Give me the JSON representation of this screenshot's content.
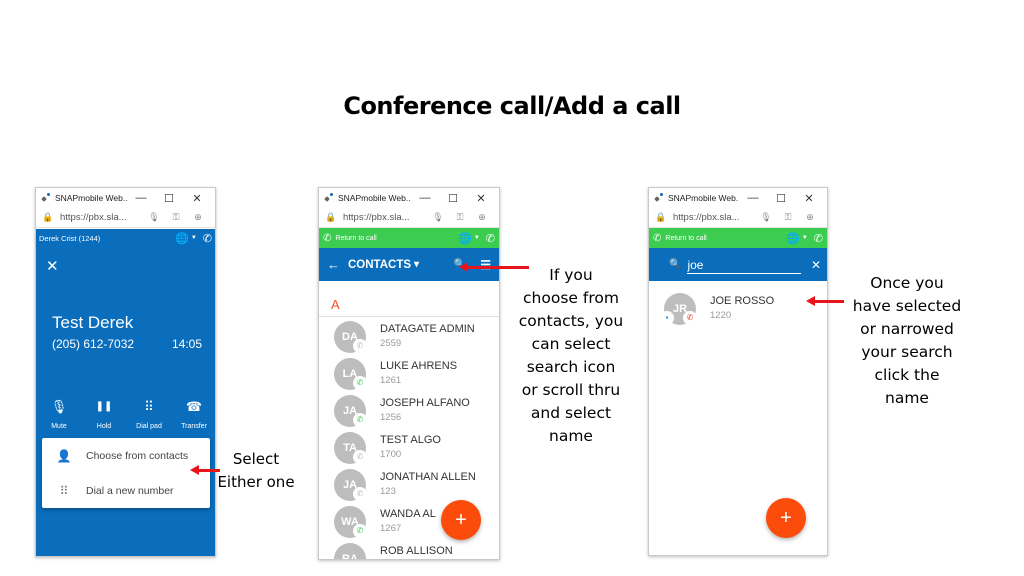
{
  "page_title": "Conference call/Add a call",
  "browser": {
    "window_title": "SNAPmobile Web...",
    "minimize": "—",
    "maximize": "☐",
    "close": "✕",
    "url": "https://pbx.sla...",
    "lock_icon": "🔒",
    "mic_icon": "🎙",
    "key_icon": "⚿",
    "zoom_icon": "⊕"
  },
  "panel1": {
    "user_label": "Derek Crist (1244)",
    "close_glyph": "✕",
    "caller_name": "Test Derek",
    "caller_number": "(205) 612-7032",
    "call_timer": "14:05",
    "controls": [
      {
        "label": "Mute",
        "icon": "🎙"
      },
      {
        "label": "Hold",
        "icon": "❚❚"
      },
      {
        "label": "Dial pad",
        "icon": "⠿"
      },
      {
        "label": "Transfer",
        "icon": "☎"
      }
    ],
    "menu": [
      {
        "label": "Choose from contacts",
        "icon": "👤"
      },
      {
        "label": "Dial a new number",
        "icon": "⠿"
      }
    ],
    "annotation": [
      "Select",
      "Either one"
    ]
  },
  "panel2": {
    "return_label": "Return to call",
    "header_title": "CONTACTS",
    "back_glyph": "←",
    "caret_glyph": "▾",
    "search_glyph": "🔍",
    "menu_glyph": "☰",
    "section_letter": "A",
    "contacts": [
      {
        "initials": "DA",
        "name": "DATAGATE ADMIN",
        "ext": "2559",
        "status": "offline"
      },
      {
        "initials": "LA",
        "name": "LUKE AHRENS",
        "ext": "1261",
        "status": "online"
      },
      {
        "initials": "JA",
        "name": "JOSEPH ALFANO",
        "ext": "1256",
        "status": "online"
      },
      {
        "initials": "TA",
        "name": "TEST ALGO",
        "ext": "1700",
        "status": "offline"
      },
      {
        "initials": "JA",
        "name": "JONATHAN ALLEN",
        "ext": "123",
        "status": "offline"
      },
      {
        "initials": "WA",
        "name": "WANDA AL",
        "ext": "1267",
        "status": "online"
      },
      {
        "initials": "RA",
        "name": "ROB ALLISON",
        "ext": "",
        "status": "offline"
      }
    ],
    "fab_glyph": "+",
    "annotation": [
      "If you",
      "choose from",
      "contacts, you",
      "can select",
      "search icon",
      "or scroll thru",
      "and select",
      "name"
    ]
  },
  "panel3": {
    "return_label": "Return to call",
    "search_value": "joe",
    "search_glyph": "🔍",
    "clear_glyph": "✕",
    "result": {
      "initials": "JR",
      "name": "JOE ROSSO",
      "ext": "1220"
    },
    "fab_glyph": "+",
    "annotation": [
      "Once you",
      "have selected",
      "or narrowed",
      "your search",
      "click the",
      "name"
    ]
  },
  "colors": {
    "app_blue": "#0a6ebd",
    "return_green": "#3ccc4f",
    "fab_orange": "#fc4c0c",
    "arrow_red": "#e8141c"
  }
}
